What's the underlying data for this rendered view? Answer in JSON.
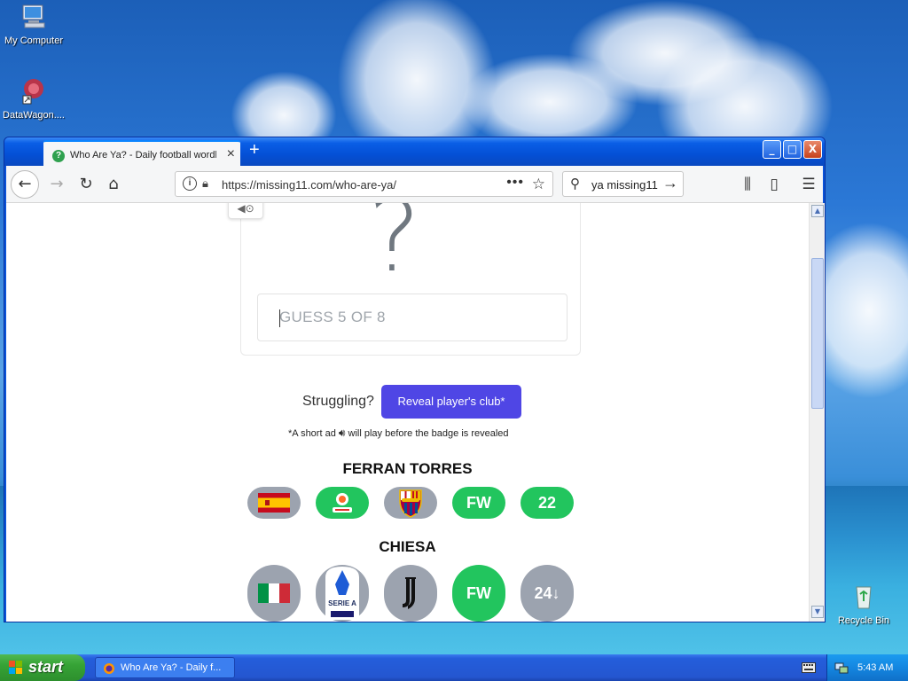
{
  "desktop": {
    "icons": [
      {
        "label": "My Computer",
        "icon": "my-computer-icon"
      },
      {
        "label": "DataWagon....",
        "icon": "datawagon-icon"
      },
      {
        "label": "Recycle Bin",
        "icon": "recycle-bin-icon"
      }
    ]
  },
  "browser": {
    "tab_title": "Who Are Ya? - Daily football wordle",
    "new_tab_label": "+",
    "url": "https://missing11.com/who-are-ya/",
    "search_value": "ya missing11",
    "window_buttons": {
      "minimize": "_",
      "maximize": "□",
      "close": "X"
    }
  },
  "page": {
    "question_mark": "?",
    "guess_placeholder": "GUESS 5 OF 8",
    "struggling_label": "Struggling?",
    "reveal_button": "Reveal player's club*",
    "ad_note_prefix": "*A short ad",
    "ad_note_suffix": "will play before the badge is revealed",
    "guesses": [
      {
        "name": "FERRAN TORRES",
        "nationality_flag": "spain-flag-icon",
        "nationality_status": "grey",
        "league_icon": "laliga-icon",
        "league_status": "green",
        "club_icon": "fc-barcelona-crest-icon",
        "club_status": "grey",
        "position": "FW",
        "position_status": "green",
        "age": "22",
        "age_status": "green"
      },
      {
        "name": "CHIESA",
        "nationality_flag": "italy-flag-icon",
        "nationality_status": "grey",
        "league_icon": "serie-a-icon",
        "league_status": "grey",
        "club_icon": "juventus-logo-icon",
        "club_status": "grey",
        "position": "FW",
        "position_status": "green",
        "age": "24↓",
        "age_status": "grey"
      }
    ]
  },
  "taskbar": {
    "start_label": "start",
    "task_label": "Who Are Ya? - Daily f...",
    "clock": "5:43 AM"
  },
  "colors": {
    "reveal_button": "#4f46e5",
    "correct": "#22c55e",
    "wrong": "#9ca3af",
    "titlebar": "#0450d6"
  }
}
